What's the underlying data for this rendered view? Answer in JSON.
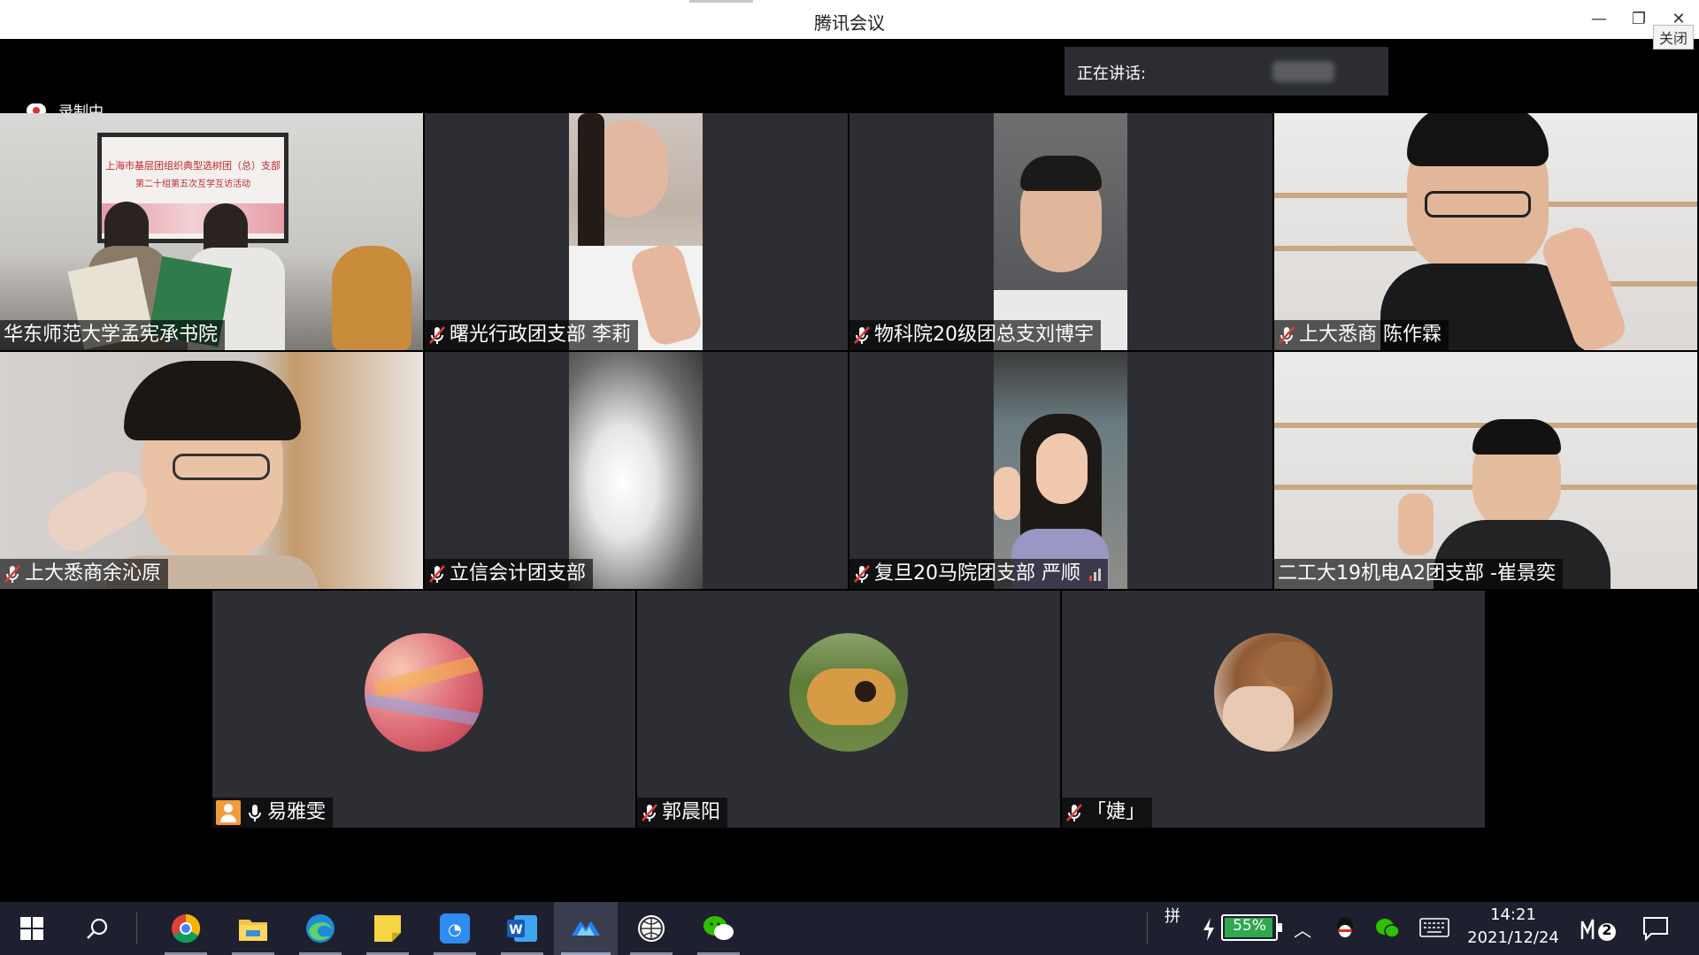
{
  "window": {
    "title": "腾讯会议",
    "close_tooltip": "关闭"
  },
  "recording": {
    "label": "录制中"
  },
  "speaking": {
    "label": "正在讲话:"
  },
  "participants": [
    {
      "name": "华东师范大学孟宪承书院",
      "muted": false,
      "kind": "video",
      "scene": "banner"
    },
    {
      "name": "曙光行政团支部 李莉",
      "muted": true,
      "kind": "video",
      "scene": "woman"
    },
    {
      "name": "物科院20级团总支刘博宇",
      "muted": true,
      "kind": "video",
      "scene": "man"
    },
    {
      "name": "上大悉商 陈作霖",
      "muted": true,
      "kind": "video",
      "scene": "shelf-man"
    },
    {
      "name": "上大悉商余沁原",
      "muted": true,
      "kind": "video",
      "scene": "girl-glasses"
    },
    {
      "name": "立信会计团支部",
      "muted": true,
      "kind": "video",
      "scene": "light"
    },
    {
      "name": "复旦20马院团支部 严顺",
      "muted": true,
      "kind": "video",
      "scene": "girl-v"
    },
    {
      "name": "二工大19机电A2团支部 -崔景奕",
      "muted": false,
      "kind": "video",
      "scene": "shelf-man2"
    },
    {
      "name": "易雅雯",
      "muted": false,
      "kind": "avatar",
      "scene": "abstract",
      "host": true
    },
    {
      "name": "郭晨阳",
      "muted": true,
      "kind": "avatar",
      "scene": "dog"
    },
    {
      "name": "「婕」",
      "muted": true,
      "kind": "avatar",
      "scene": "bear"
    }
  ],
  "banner": {
    "line1": "上海市基层团组织典型选树团（总）支部",
    "line2": "第二十组第五次互学互访活动"
  },
  "taskbar": {
    "apps": [
      "start-icon",
      "search-icon",
      "chrome-icon",
      "file-explorer-icon",
      "edge-icon",
      "sticky-notes-icon",
      "dingtalk-icon",
      "word-icon",
      "tencent-meeting-icon",
      "globe-app-icon",
      "wechat-icon"
    ],
    "ime": "拼",
    "battery": "55%",
    "time": "14:21",
    "date": "2021/12/24",
    "notification_count": "2"
  }
}
